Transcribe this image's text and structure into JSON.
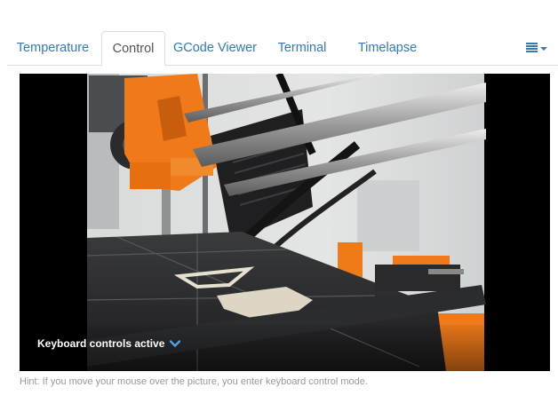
{
  "tabs": [
    {
      "label": "Temperature",
      "active": false
    },
    {
      "label": "Control",
      "active": true
    },
    {
      "label": "GCode Viewer",
      "active": false
    },
    {
      "label": "Terminal",
      "active": false
    },
    {
      "label": "Timelapse",
      "active": false
    }
  ],
  "tab_menu_icon": "list-icon",
  "webcam": {
    "overlay_text": "Keyboard controls active",
    "overlay_icon": "chevron-down-icon",
    "hint": "Hint: If you move your mouse over the picture, you enter keyboard control mode."
  },
  "colors": {
    "link": "#337ab7",
    "printer_orange": "#f07a1a",
    "hint_text": "#999999"
  }
}
